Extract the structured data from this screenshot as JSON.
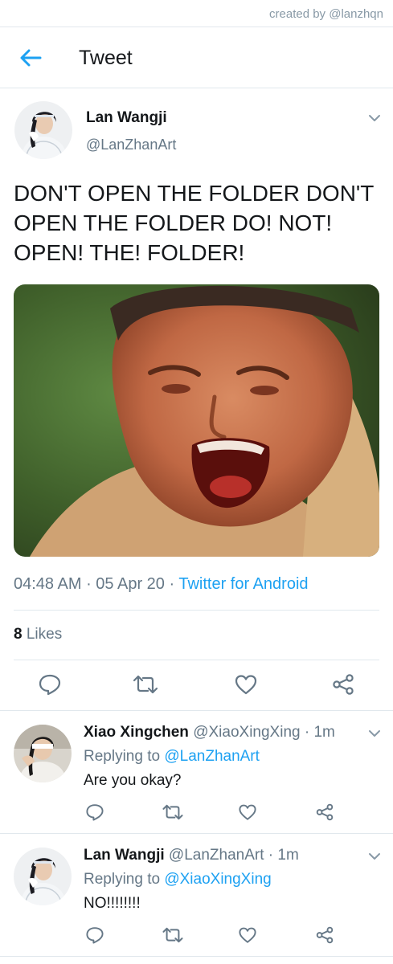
{
  "credit": "created by @lanzhqn",
  "header": {
    "title": "Tweet"
  },
  "tweet": {
    "author_name": "Lan Wangji",
    "author_handle": "@LanZhanArt",
    "text": "DON'T OPEN THE FOLDER DON'T OPEN THE FOLDER DO! NOT! OPEN! THE! FOLDER!",
    "time": "04:48 AM",
    "date": "05 Apr 20",
    "source": "Twitter for Android",
    "likes_count": "8",
    "likes_label": "Likes"
  },
  "replies": [
    {
      "name": "Xiao Xingchen",
      "handle": "@XiaoXingXing",
      "time": "1m",
      "replying_label": "Replying to",
      "replying_to": "@LanZhanArt",
      "text": "Are you okay?"
    },
    {
      "name": "Lan Wangji",
      "handle": "@LanZhanArt",
      "time": "1m",
      "replying_label": "Replying to",
      "replying_to": "@XiaoXingXing",
      "text": "NO!!!!!!!!"
    }
  ],
  "icons": {
    "back": "arrow-left-icon",
    "caret": "chevron-down-icon",
    "reply": "reply-icon",
    "retweet": "retweet-icon",
    "like": "heart-icon",
    "share": "share-icon"
  },
  "colors": {
    "accent": "#1da1f2",
    "text": "#14171a",
    "secondary": "#657786",
    "divider": "#e1e8ed"
  }
}
